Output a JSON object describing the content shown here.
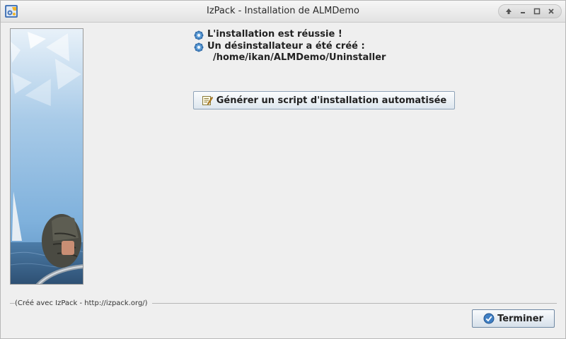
{
  "window": {
    "title": "IzPack - Installation de ALMDemo",
    "app_icon": "izpack-app-icon",
    "controls": [
      "up-arrow-icon",
      "minimize-icon",
      "maximize-icon",
      "close-icon"
    ]
  },
  "banner": {
    "image": "sailing-banner-image"
  },
  "messages": {
    "success": "L'installation est réussie !",
    "uninstaller_created": "Un désinstallateur a été créé :",
    "uninstaller_path": "/home/ikan/ALMDemo/Uninstaller",
    "bullet_icon": "gear-bullet-icon"
  },
  "actions": {
    "generate_script_label": "Générer un script d'installation automatisée",
    "generate_script_icon": "edit-script-icon",
    "finish_label": "Terminer",
    "finish_icon": "checkmark-icon"
  },
  "footer": {
    "credit": "(Créé avec IzPack - http://izpack.org/)"
  },
  "colors": {
    "window_bg": "#efefef",
    "button_border": "#8fa3b8",
    "accent_blue": "#3f7fc4"
  }
}
